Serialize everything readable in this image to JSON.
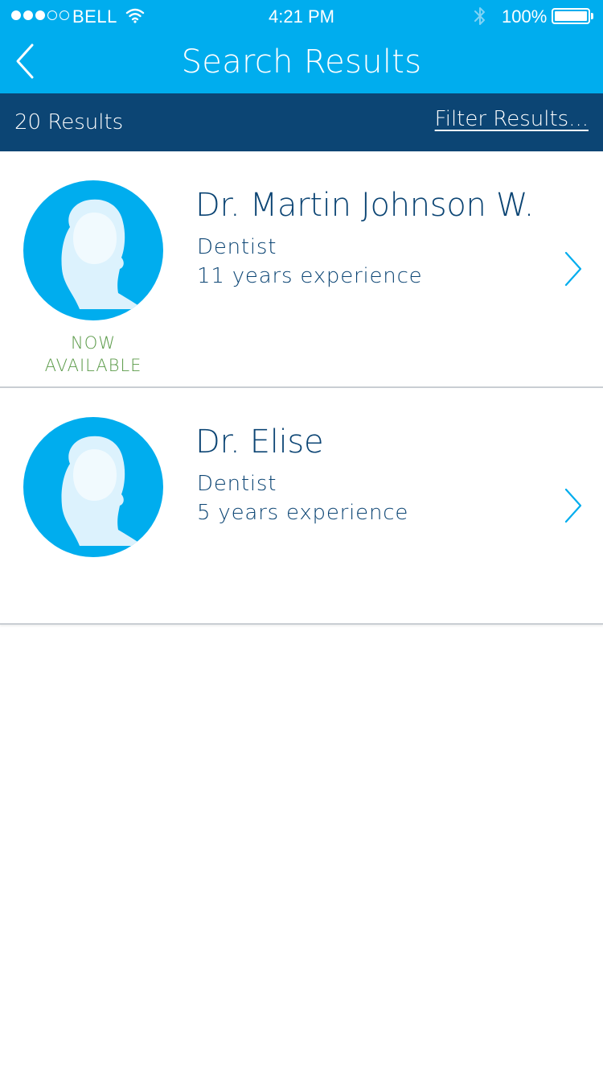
{
  "status_bar": {
    "carrier": "BELL",
    "time": "4:21 PM",
    "battery": "100%",
    "signal_bars_filled": 3,
    "signal_bars_total": 5,
    "battery_level": 1.0
  },
  "nav": {
    "title": "Search Results",
    "back_icon": "chevron-left-icon"
  },
  "results_bar": {
    "count_label": "20 Results",
    "filter_label": "Filter Results..."
  },
  "colors": {
    "primary": "#00adee",
    "dark_blue": "#0c4574",
    "available_green": "#5a9a48",
    "divider": "#c9ced3"
  },
  "doctors": [
    {
      "name": "Dr. Martin Johnson W.",
      "specialty": "Dentist",
      "experience": "11 years experience",
      "availability_line1": "NOW",
      "availability_line2": "AVAILABLE",
      "avatar_icon": "person-silhouette-icon",
      "chevron_icon": "chevron-right-icon"
    },
    {
      "name": "Dr. Elise",
      "specialty": "Dentist",
      "experience": "5 years experience",
      "avatar_icon": "person-silhouette-icon",
      "chevron_icon": "chevron-right-icon"
    }
  ]
}
